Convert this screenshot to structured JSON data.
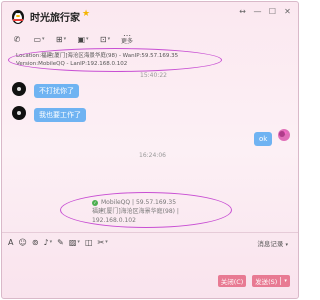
{
  "window": {
    "title": "时光旅行家",
    "controls": [
      "↔",
      "—",
      "☐",
      "✕"
    ]
  },
  "toolbar": {
    "icons": [
      "phone-icon",
      "video-icon",
      "screen-share-icon",
      "file-icon",
      "apps-icon",
      "more-icon"
    ],
    "glyphs": [
      "✆",
      "▭",
      "⊞",
      "▣",
      "⊡",
      "⋯"
    ],
    "more_label": "更多"
  },
  "messages": {
    "location": {
      "line1": "Location:福建[厦门]海沧区海景华庭(98) - WanIP:59.57.169.35",
      "line2": "Version:MobileQQ - LanIP:192.168.0.102"
    },
    "time1": "15:40:22",
    "msg1": "不打扰你了",
    "msg2": "我也要工作了",
    "my_msg": "ok",
    "time2": "16:24:06",
    "info_card": {
      "line1": "MobileQQ | 59.57.169.35",
      "line2": "福建[厦门]海沧区海景华庭(98) | 192.168.0.102"
    }
  },
  "input_toolbar": {
    "icons": [
      "font-icon",
      "emoji-icon",
      "vip-emoji-icon",
      "mic-icon",
      "screenshot-icon",
      "image-icon",
      "wallet-icon",
      "scissors-icon"
    ],
    "glyphs": [
      "A",
      "☺",
      "⊚",
      "🎙",
      "✂",
      "🖼",
      "◫",
      "✂"
    ],
    "history_label": "消息记录"
  },
  "buttons": {
    "close": "关闭(C)",
    "send": "发送(S)"
  },
  "colors": {
    "accent": "#e87a93",
    "bubble": "#6fb3f2",
    "highlight_oval": "#c84fd3"
  }
}
